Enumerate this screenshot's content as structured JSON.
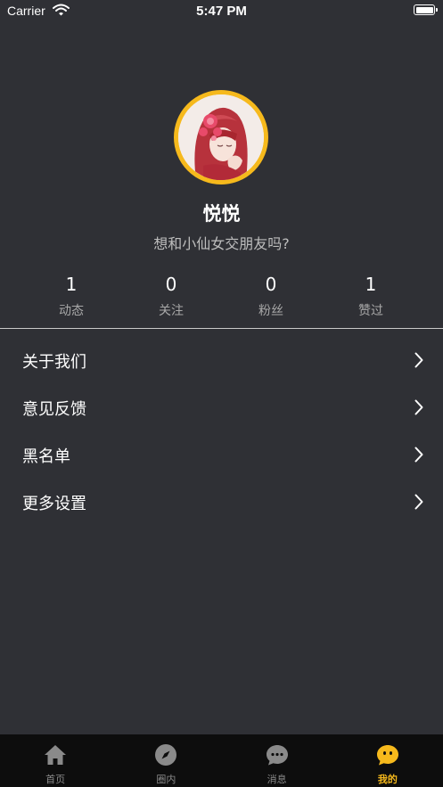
{
  "status_bar": {
    "carrier": "Carrier",
    "time": "5:47 PM"
  },
  "profile": {
    "nickname": "悦悦",
    "signature": "想和小仙女交朋友吗?"
  },
  "stats": [
    {
      "value": "1",
      "label": "动态"
    },
    {
      "value": "0",
      "label": "关注"
    },
    {
      "value": "0",
      "label": "粉丝"
    },
    {
      "value": "1",
      "label": "赞过"
    }
  ],
  "menu": [
    {
      "label": "关于我们"
    },
    {
      "label": "意见反馈"
    },
    {
      "label": "黑名单"
    },
    {
      "label": "更多设置"
    }
  ],
  "tab_bar": {
    "active": "我的",
    "tabs": [
      {
        "label": "首页",
        "icon": "home-icon"
      },
      {
        "label": "圈内",
        "icon": "compass-icon"
      },
      {
        "label": "消息",
        "icon": "chat-bubble-icon"
      },
      {
        "label": "我的",
        "icon": "face-icon"
      }
    ]
  },
  "colors": {
    "background": "#2f3035",
    "accent": "#f6b91c",
    "tab_bar": "#0d0d0d"
  }
}
